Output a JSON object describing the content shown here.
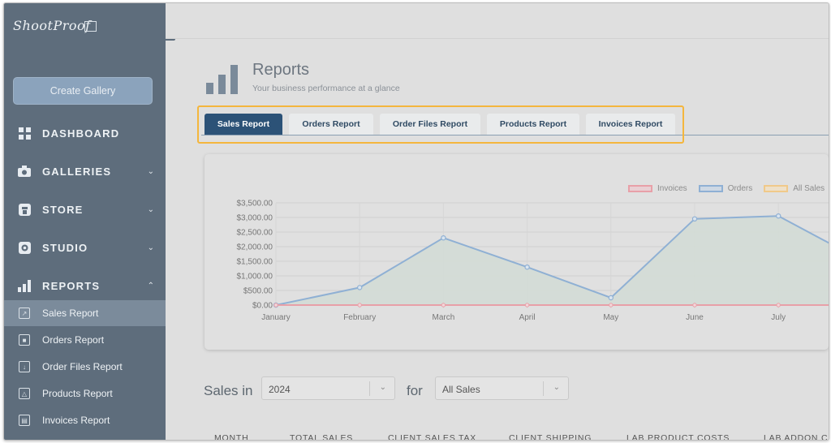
{
  "brand": {
    "name": "ShootProof"
  },
  "sidebar": {
    "create_label": "Create Gallery",
    "nav": [
      {
        "label": "DASHBOARD"
      },
      {
        "label": "GALLERIES"
      },
      {
        "label": "STORE"
      },
      {
        "label": "STUDIO"
      },
      {
        "label": "REPORTS"
      }
    ],
    "sub": [
      {
        "label": "Sales Report"
      },
      {
        "label": "Orders Report"
      },
      {
        "label": "Order Files Report"
      },
      {
        "label": "Products Report"
      },
      {
        "label": "Invoices Report"
      }
    ]
  },
  "header": {
    "title": "Reports",
    "subtitle": "Your business performance at a glance"
  },
  "tabs": [
    {
      "label": "Sales Report"
    },
    {
      "label": "Orders Report"
    },
    {
      "label": "Order Files Report"
    },
    {
      "label": "Products Report"
    },
    {
      "label": "Invoices Report"
    }
  ],
  "filters": {
    "sales_in_label": "Sales in",
    "year_value": "2024",
    "for_label": "for",
    "type_value": "All Sales"
  },
  "table": {
    "headers": [
      "MONTH",
      "TOTAL SALES",
      "CLIENT SALES TAX",
      "CLIENT SHIPPING",
      "LAB PRODUCT COSTS",
      "LAB ADDON C"
    ]
  },
  "colors": {
    "sidebar": "#5e6d7c",
    "active_tab": "#2c5277",
    "highlight": "#f4b63d",
    "orders": "#8fb0d4",
    "invoices": "#e8a0a8",
    "all_sales": "#f0c98a"
  },
  "chart_data": {
    "type": "line",
    "categories": [
      "January",
      "February",
      "March",
      "April",
      "May",
      "June",
      "July"
    ],
    "series": [
      {
        "name": "Invoices",
        "values": [
          0,
          0,
          0,
          0,
          0,
          0,
          0
        ]
      },
      {
        "name": "Orders",
        "values": [
          0,
          600,
          2300,
          1300,
          250,
          2950,
          3050
        ]
      },
      {
        "name": "All Sales",
        "values": [
          0,
          0,
          0,
          0,
          0,
          0,
          0
        ]
      }
    ],
    "yticks": [
      "$0.00",
      "$500.00",
      "$1,000.00",
      "$1,500.00",
      "$2,000.00",
      "$2,500.00",
      "$3,000.00",
      "$3,500.00"
    ],
    "ylim": [
      0,
      3500
    ],
    "legend_position": "top-right",
    "grid": true
  }
}
